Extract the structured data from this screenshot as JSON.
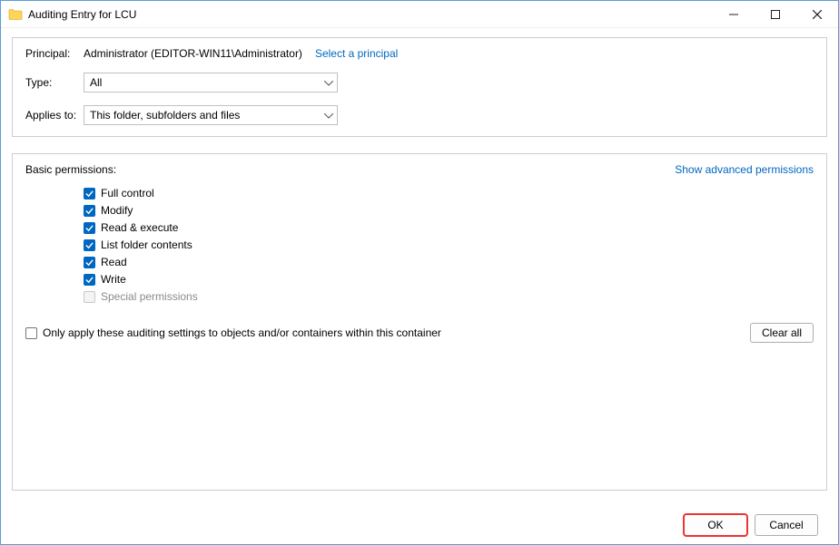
{
  "window": {
    "title": "Auditing Entry for LCU"
  },
  "top": {
    "principal_label": "Principal:",
    "principal_value": "Administrator (EDITOR-WIN11\\Administrator)",
    "select_principal_link": "Select a principal",
    "type_label": "Type:",
    "type_value": "All",
    "applies_label": "Applies to:",
    "applies_value": "This folder, subfolders and files"
  },
  "permissions": {
    "heading": "Basic permissions:",
    "advanced_link": "Show advanced permissions",
    "items": [
      {
        "label": "Full control",
        "checked": true,
        "disabled": false
      },
      {
        "label": "Modify",
        "checked": true,
        "disabled": false
      },
      {
        "label": "Read & execute",
        "checked": true,
        "disabled": false
      },
      {
        "label": "List folder contents",
        "checked": true,
        "disabled": false
      },
      {
        "label": "Read",
        "checked": true,
        "disabled": false
      },
      {
        "label": "Write",
        "checked": true,
        "disabled": false
      },
      {
        "label": "Special permissions",
        "checked": false,
        "disabled": true
      }
    ],
    "only_apply_label": "Only apply these auditing settings to objects and/or containers within this container",
    "only_apply_checked": false,
    "clear_all": "Clear all"
  },
  "footer": {
    "ok": "OK",
    "cancel": "Cancel"
  }
}
